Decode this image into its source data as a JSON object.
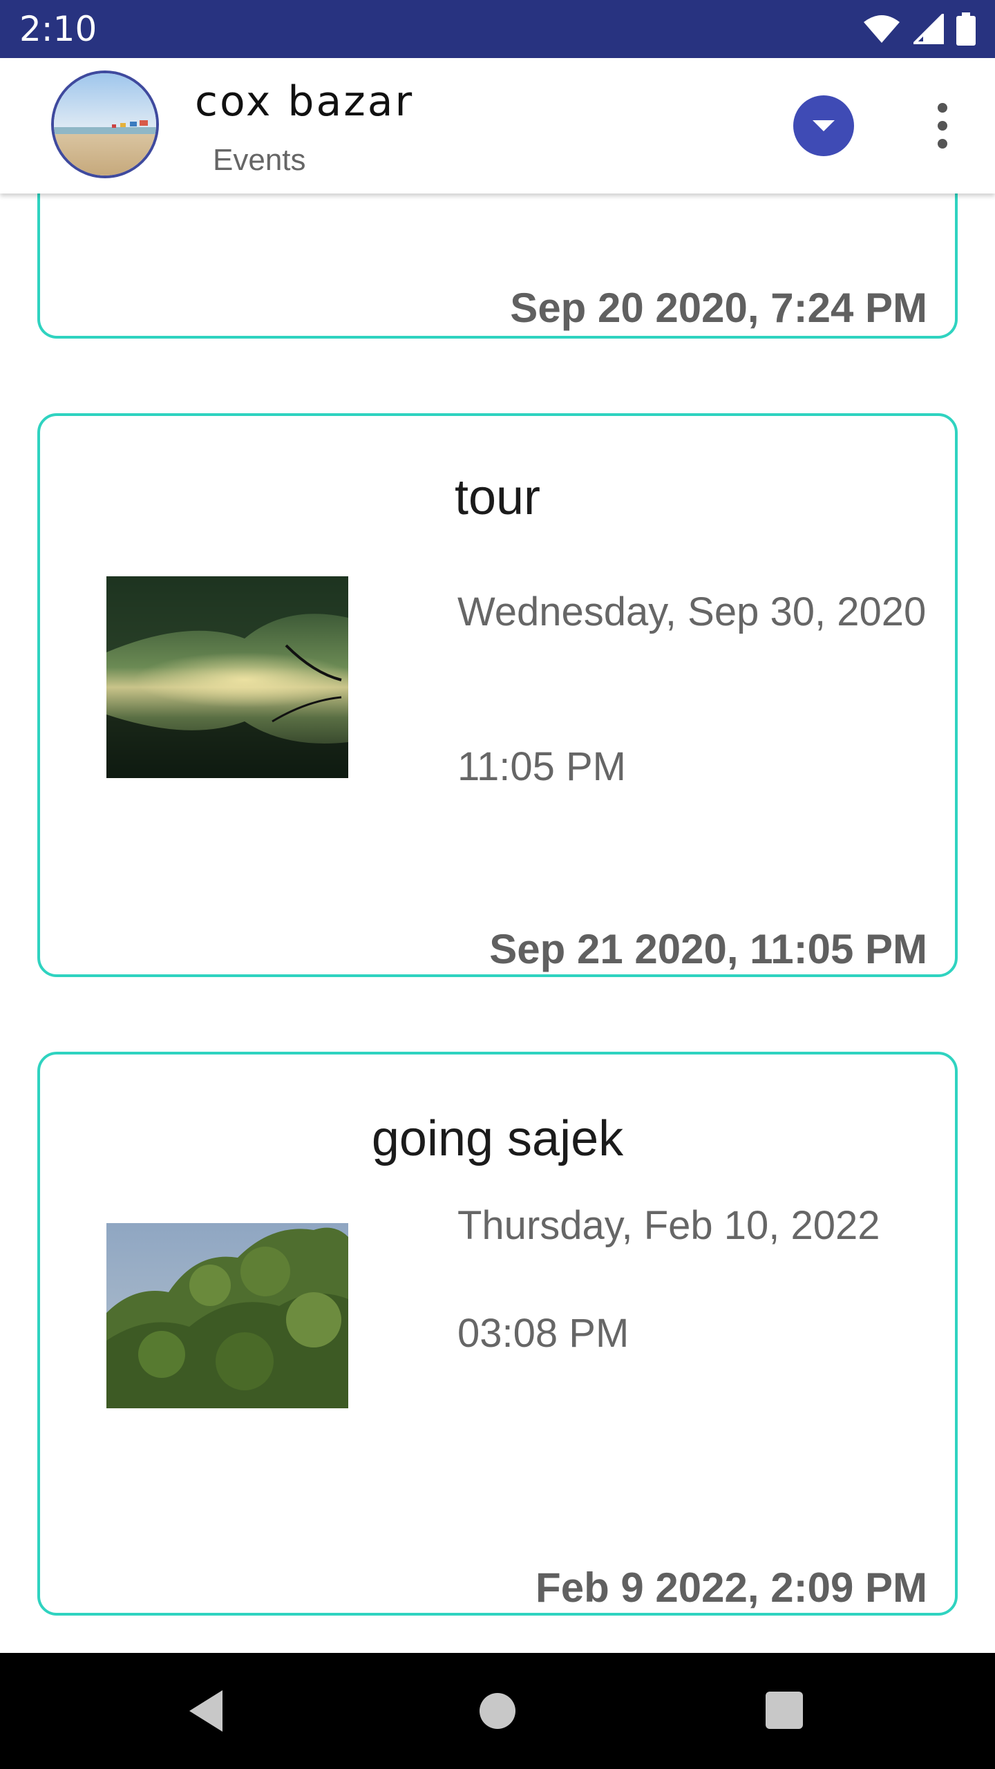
{
  "status_bar": {
    "time": "2:10",
    "icons": [
      "wifi-icon",
      "signal-icon",
      "battery-icon"
    ]
  },
  "toolbar": {
    "title": "cox bazar",
    "subtitle": "Events",
    "avatar": "beach-avatar",
    "dropdown_icon": "chevron-down-icon",
    "menu_icon": "more-vert-icon"
  },
  "events": [
    {
      "created": "Sep 20 2020, 7:24 PM"
    },
    {
      "title": "tour",
      "date": "Wednesday, Sep 30, 2020",
      "time": "11:05 PM",
      "created": "Sep 21 2020, 11:05 PM",
      "thumbnail": "misty-river-forest"
    },
    {
      "title": "going sajek",
      "date": "Thursday, Feb 10, 2022",
      "time": "03:08 PM",
      "created": "Feb 9 2022, 2:09 PM",
      "thumbnail": "green-trees"
    }
  ],
  "nav_bar": {
    "buttons": [
      "back-icon",
      "home-icon",
      "recents-icon"
    ]
  },
  "colors": {
    "status_bar": "#283380",
    "accent": "#3f4bb5",
    "card_border": "#2fd3c0",
    "secondary_text": "#666666"
  }
}
